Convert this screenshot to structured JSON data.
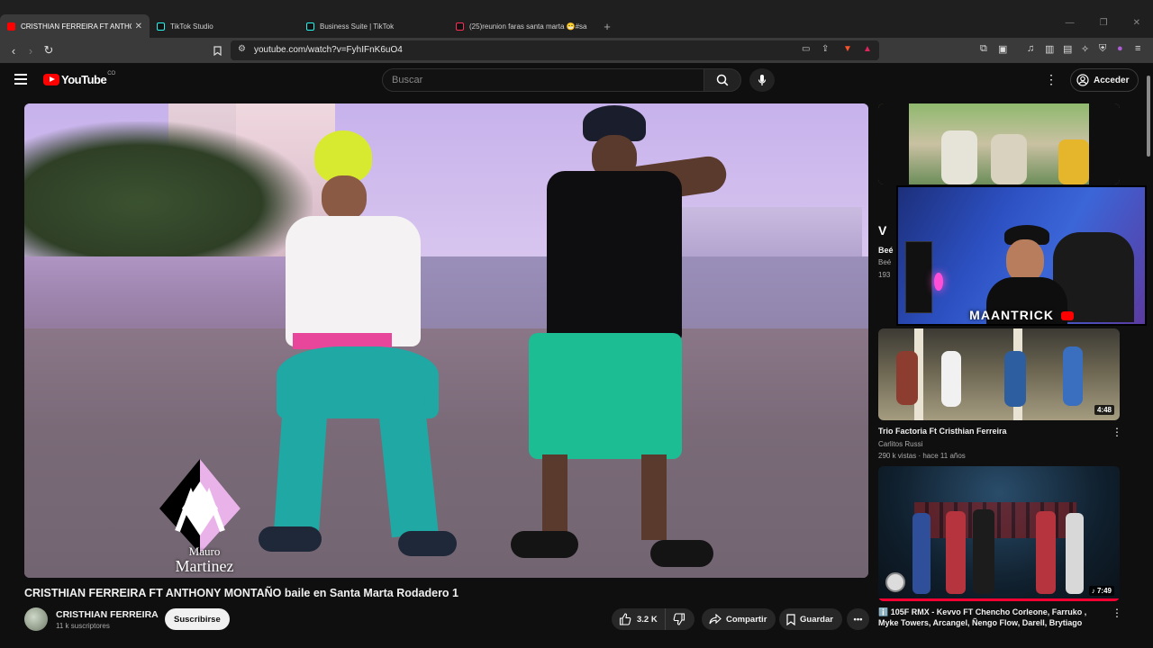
{
  "browser": {
    "tabs": [
      {
        "title": "CRISTHIAN FERREIRA FT ANTHON",
        "active": true,
        "favicon": "youtube-favicon"
      },
      {
        "title": "TikTok Studio",
        "active": false,
        "favicon": "tiktok-favicon"
      },
      {
        "title": "Business Suite | TikTok",
        "active": false,
        "favicon": "tiktok-favicon"
      },
      {
        "title": "(25)reunion faras santa marta 😁#sa",
        "active": false,
        "favicon": "tiktok-favicon"
      }
    ],
    "new_tab": "+",
    "url": "youtube.com/watch?v=FyhIFnK6uO4"
  },
  "youtube": {
    "logo_text": "YouTube",
    "logo_country": "CO",
    "search_placeholder": "Buscar",
    "signin_label": "Acceder"
  },
  "video": {
    "title": "CRISTHIAN FERREIRA FT ANTHONY MONTAÑO baile en Santa Marta Rodadero 1",
    "watermark_line1": "Mauro",
    "watermark_line2": "Martinez"
  },
  "channel": {
    "name": "CRISTHIAN FERREIRA",
    "subscribers": "11 k suscriptores",
    "subscribe_label": "Suscribirse"
  },
  "actions": {
    "likes": "3.2 K",
    "share_label": "Compartir",
    "save_label": "Guardar"
  },
  "sidebar": {
    "partial": {
      "title": "Beé",
      "subtitle": "Beé",
      "meta": "193"
    },
    "items": [
      {
        "title": "Trio Factoria Ft Cristhian Ferreira",
        "channel": "Carlitos Russi",
        "meta": "290 k vistas · hace 11 años",
        "duration": "4:48"
      },
      {
        "title": "ℹ️ 105F RMX - Kevvo FT Chencho Corleone, Farruko , Myke Towers, Arcangel, Ñengo Flow, Darell, Brytiago",
        "duration": "7:49"
      }
    ]
  },
  "webcam": {
    "label": "MAANTRICK"
  }
}
